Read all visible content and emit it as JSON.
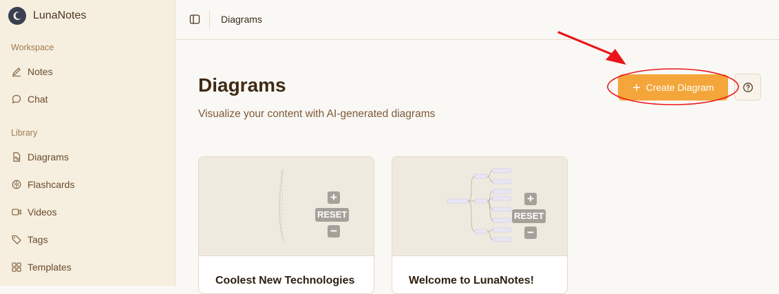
{
  "app": {
    "name": "LunaNotes"
  },
  "sidebar": {
    "sections": [
      {
        "label": "Workspace",
        "items": [
          {
            "label": "Notes",
            "icon": "pencil-icon"
          },
          {
            "label": "Chat",
            "icon": "chat-bubble-icon"
          }
        ]
      },
      {
        "label": "Library",
        "items": [
          {
            "label": "Diagrams",
            "icon": "diagram-file-icon"
          },
          {
            "label": "Flashcards",
            "icon": "brain-icon"
          },
          {
            "label": "Videos",
            "icon": "video-camera-icon"
          },
          {
            "label": "Tags",
            "icon": "tag-icon"
          },
          {
            "label": "Templates",
            "icon": "grid-icon"
          }
        ]
      }
    ]
  },
  "header": {
    "breadcrumb": "Diagrams"
  },
  "main": {
    "title": "Diagrams",
    "subtitle": "Visualize your content with AI-generated diagrams",
    "create_label": "Create Diagram",
    "cards": [
      {
        "title": "Coolest New Technologies",
        "zoom": {
          "plus": "+",
          "reset": "RESET",
          "minus": "−"
        }
      },
      {
        "title": "Welcome to LunaNotes!",
        "zoom": {
          "plus": "+",
          "reset": "RESET",
          "minus": "−"
        }
      }
    ]
  },
  "colors": {
    "accent": "#f4a63a",
    "sidebar_bg": "#f6efe0",
    "annotation": "#e8161b"
  }
}
